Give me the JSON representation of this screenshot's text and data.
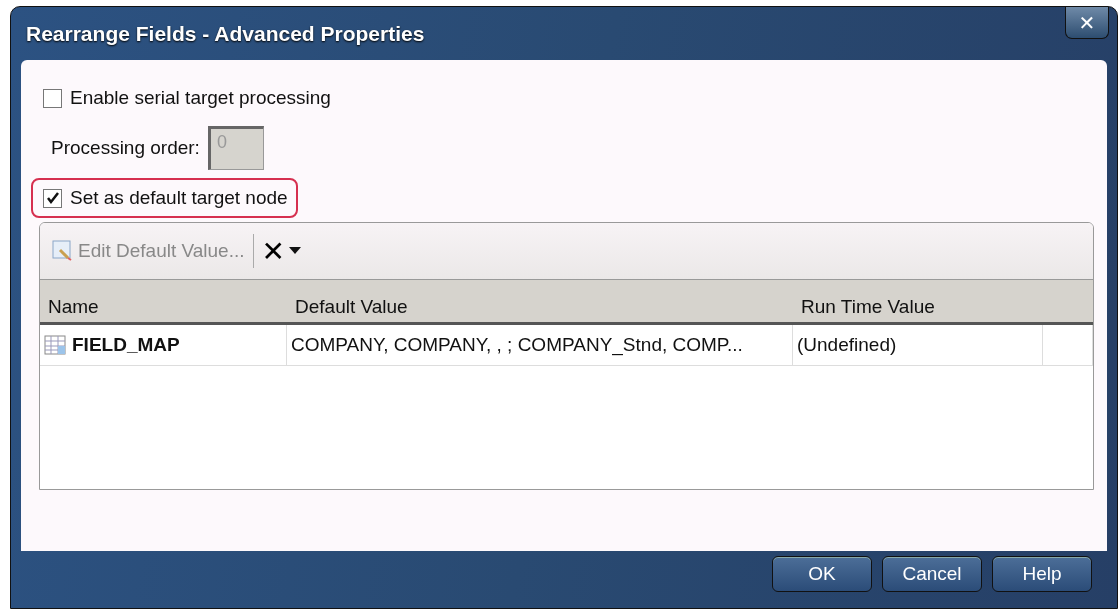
{
  "window": {
    "title": "Rearrange Fields - Advanced Properties",
    "close": "✕"
  },
  "options": [
    {
      "kind": "checkbox",
      "label": "Enable serial target processing",
      "checked": false,
      "highlighted": false
    },
    {
      "kind": "field",
      "label": "Processing order:",
      "value": "0",
      "disabled": true
    },
    {
      "kind": "checkbox",
      "label": "Set as default target node",
      "checked": true,
      "highlighted": true
    }
  ],
  "toolbar": {
    "edit_button": {
      "label": "Edit Default Value...",
      "disabled": true
    },
    "delete_button": {
      "label": "✕"
    }
  },
  "table": {
    "columns": [
      "Name",
      "Default Value",
      "Run Time Value"
    ],
    "rows": [
      {
        "name": "FIELD_MAP",
        "default_value": "COMPANY, COMPANY, , ; COMPANY_Stnd, COMP...",
        "run_time_value": "(Undefined)"
      }
    ]
  },
  "buttons": [
    "OK",
    "Cancel",
    "Help"
  ]
}
